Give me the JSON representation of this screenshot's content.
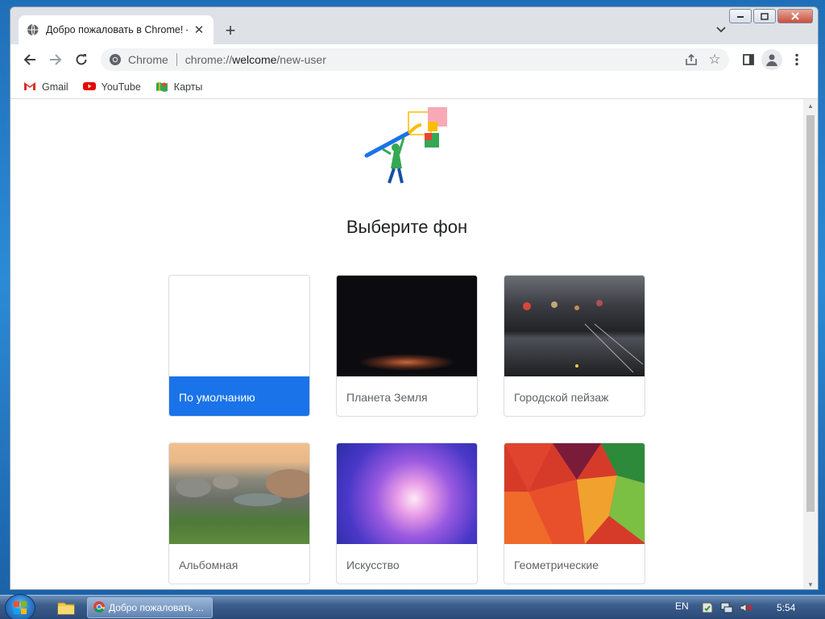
{
  "window": {
    "tab_title": "Добро пожаловать в Chrome! -",
    "tab_close": "✕",
    "new_tab": "+"
  },
  "toolbar": {
    "omnibox_chip": "Chrome",
    "url_scheme": "chrome://",
    "url_host": "welcome",
    "url_path": "/new-user"
  },
  "bookmarks": [
    {
      "label": "Gmail",
      "icon": "gmail-icon"
    },
    {
      "label": "YouTube",
      "icon": "youtube-icon"
    },
    {
      "label": "Карты",
      "icon": "maps-icon"
    }
  ],
  "page": {
    "heading": "Выберите фон",
    "cards": [
      {
        "label": "По умолчанию",
        "selected": true
      },
      {
        "label": "Планета Земля",
        "selected": false
      },
      {
        "label": "Городской пейзаж",
        "selected": false
      },
      {
        "label": "Альбомная",
        "selected": false
      },
      {
        "label": "Искусство",
        "selected": false
      },
      {
        "label": "Геометрические",
        "selected": false
      }
    ]
  },
  "taskbar": {
    "task_label": "Добро пожаловать ...",
    "language": "EN",
    "clock": "5:54"
  },
  "colors": {
    "accent": "#1a73e8",
    "toolbar_bg": "#ffffff",
    "tabstrip_bg": "#dee1e6"
  }
}
